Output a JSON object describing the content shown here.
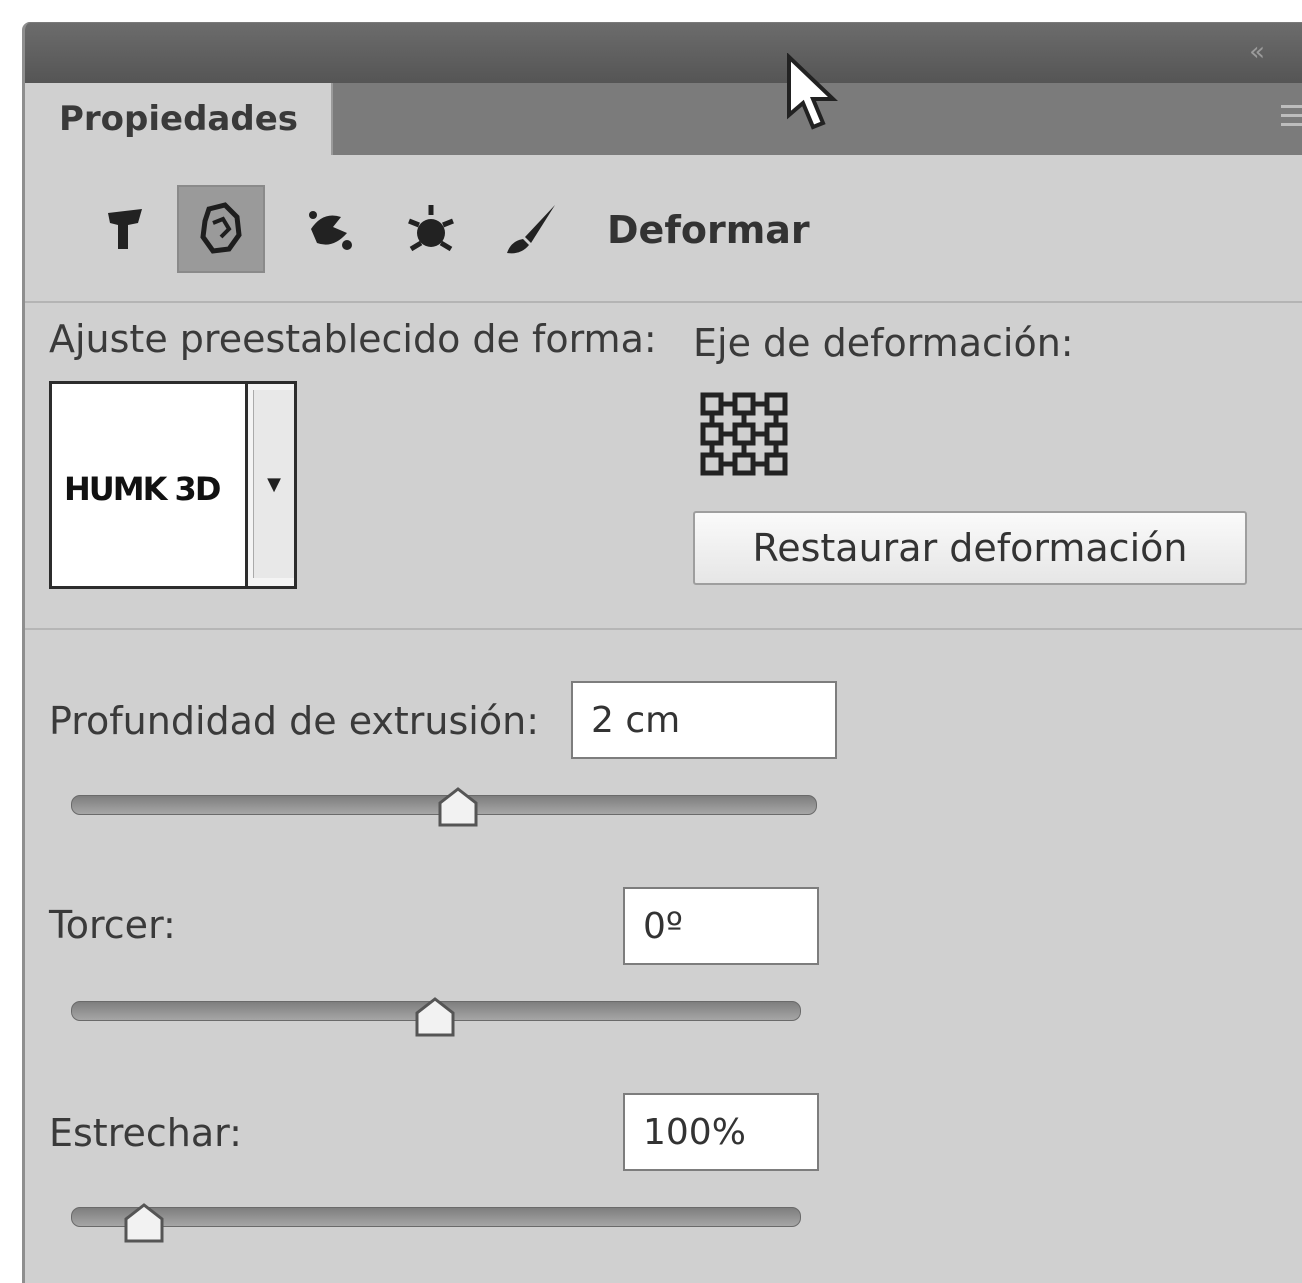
{
  "panel": {
    "tab_label": "Propiedades",
    "collapse_icon": "double-chevron-left-icon",
    "close_icon": "close-icon",
    "menu_icon": "panel-menu-icon"
  },
  "toolbar": {
    "tools": [
      "mesh-icon",
      "deform-icon",
      "color-icon",
      "lighting-icon",
      "brush-icon"
    ],
    "selected_tool": "deform-icon",
    "section_title": "Deformar"
  },
  "preset": {
    "label": "Ajuste preestablecido de forma:",
    "thumbnail_text": "HUMK 3D"
  },
  "axis": {
    "label": "Eje de deformación:",
    "reset_button": "Restaurar deformación"
  },
  "extrusion": {
    "label": "Profundidad de extrusión:",
    "value": "2 cm",
    "slider_fraction": 0.52
  },
  "twist": {
    "label": "Torcer:",
    "value": "0º",
    "slider_fraction": 0.5
  },
  "taper": {
    "label": "Estrechar:",
    "value": "100%",
    "slider_fraction": 0.1
  }
}
